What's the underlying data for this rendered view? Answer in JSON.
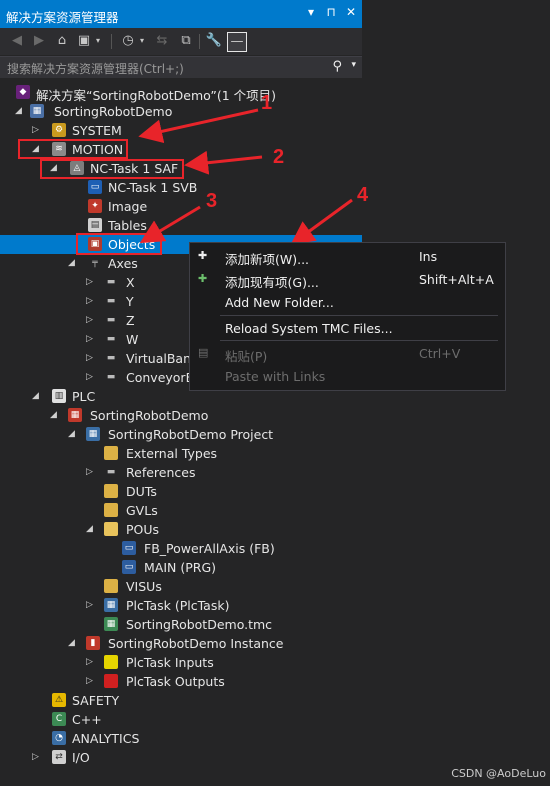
{
  "panel": {
    "title": "解决方案资源管理器",
    "title_buttons": [
      "▾",
      "⊓",
      "✕"
    ],
    "search_placeholder": "搜索解决方案资源管理器(Ctrl+;)"
  },
  "tree": [
    {
      "label": "解决方案“SortingRobotDemo”(1 个项目)",
      "icon": "solution-icon",
      "expand": ""
    },
    {
      "label": "SortingRobotDemo",
      "icon": "twincat-project-icon",
      "expand": "◢"
    },
    {
      "label": "SYSTEM",
      "icon": "system-icon",
      "expand": "▷"
    },
    {
      "label": "MOTION",
      "icon": "motion-icon",
      "expand": "◢"
    },
    {
      "label": "NC-Task 1 SAF",
      "icon": "nc-task-icon",
      "expand": "◢"
    },
    {
      "label": "NC-Task 1 SVB",
      "icon": "nc-svb-icon",
      "expand": ""
    },
    {
      "label": "Image",
      "icon": "image-icon",
      "expand": ""
    },
    {
      "label": "Tables",
      "icon": "tables-icon",
      "expand": ""
    },
    {
      "label": "Objects",
      "icon": "objects-icon",
      "expand": ""
    },
    {
      "label": "Axes",
      "icon": "axes-icon",
      "expand": "◢"
    },
    {
      "label": "X",
      "icon": "axis-icon",
      "expand": "▷"
    },
    {
      "label": "Y",
      "icon": "axis-icon",
      "expand": "▷"
    },
    {
      "label": "Z",
      "icon": "axis-icon",
      "expand": "▷"
    },
    {
      "label": "W",
      "icon": "axis-icon",
      "expand": "▷"
    },
    {
      "label": "VirtualBand",
      "icon": "axis-icon",
      "expand": "▷"
    },
    {
      "label": "ConveyorB",
      "icon": "axis-icon",
      "expand": "▷"
    },
    {
      "label": "PLC",
      "icon": "plc-icon",
      "expand": "◢"
    },
    {
      "label": "SortingRobotDemo",
      "icon": "plc-project-icon",
      "expand": "◢"
    },
    {
      "label": "SortingRobotDemo Project",
      "icon": "plc-subproject-icon",
      "expand": "◢"
    },
    {
      "label": "External Types",
      "icon": "folder-icon",
      "expand": ""
    },
    {
      "label": "References",
      "icon": "references-icon",
      "expand": "▷"
    },
    {
      "label": "DUTs",
      "icon": "folder-icon",
      "expand": ""
    },
    {
      "label": "GVLs",
      "icon": "folder-icon",
      "expand": ""
    },
    {
      "label": "POUs",
      "icon": "folder-open-icon",
      "expand": "◢"
    },
    {
      "label": "FB_PowerAllAxis (FB)",
      "icon": "pou-icon",
      "expand": ""
    },
    {
      "label": "MAIN (PRG)",
      "icon": "pou-icon",
      "expand": ""
    },
    {
      "label": "VISUs",
      "icon": "folder-icon",
      "expand": ""
    },
    {
      "label": "PlcTask (PlcTask)",
      "icon": "task-icon",
      "expand": "▷"
    },
    {
      "label": "SortingRobotDemo.tmc",
      "icon": "tmc-icon",
      "expand": ""
    },
    {
      "label": "SortingRobotDemo Instance",
      "icon": "instance-icon",
      "expand": "◢"
    },
    {
      "label": "PlcTask Inputs",
      "icon": "inputs-icon",
      "expand": "▷"
    },
    {
      "label": "PlcTask Outputs",
      "icon": "outputs-icon",
      "expand": "▷"
    },
    {
      "label": "SAFETY",
      "icon": "safety-icon",
      "expand": ""
    },
    {
      "label": "C++",
      "icon": "cpp-icon",
      "expand": ""
    },
    {
      "label": "ANALYTICS",
      "icon": "analytics-icon",
      "expand": ""
    },
    {
      "label": "I/O",
      "icon": "io-icon",
      "expand": "▷"
    }
  ],
  "context_menu": [
    {
      "label": "添加新项(W)...",
      "shortcut": "Ins",
      "icon": "add-new-item-icon",
      "enabled": true
    },
    {
      "label": "添加现有项(G)...",
      "shortcut": "Shift+Alt+A",
      "icon": "add-existing-item-icon",
      "enabled": true
    },
    {
      "label": "Add New Folder...",
      "shortcut": "",
      "icon": "",
      "enabled": true
    },
    {
      "label": "Reload System TMC Files...",
      "shortcut": "",
      "icon": "",
      "enabled": true
    },
    {
      "label": "粘贴(P)",
      "shortcut": "Ctrl+V",
      "icon": "paste-icon",
      "enabled": false
    },
    {
      "label": "Paste with Links",
      "shortcut": "",
      "icon": "",
      "enabled": false
    }
  ],
  "annotations": [
    "1",
    "2",
    "3",
    "4"
  ],
  "watermark": "CSDN @AoDeLuo",
  "colors": {
    "accent": "#007acc",
    "annotation": "#e8242a",
    "background": "#252526"
  }
}
